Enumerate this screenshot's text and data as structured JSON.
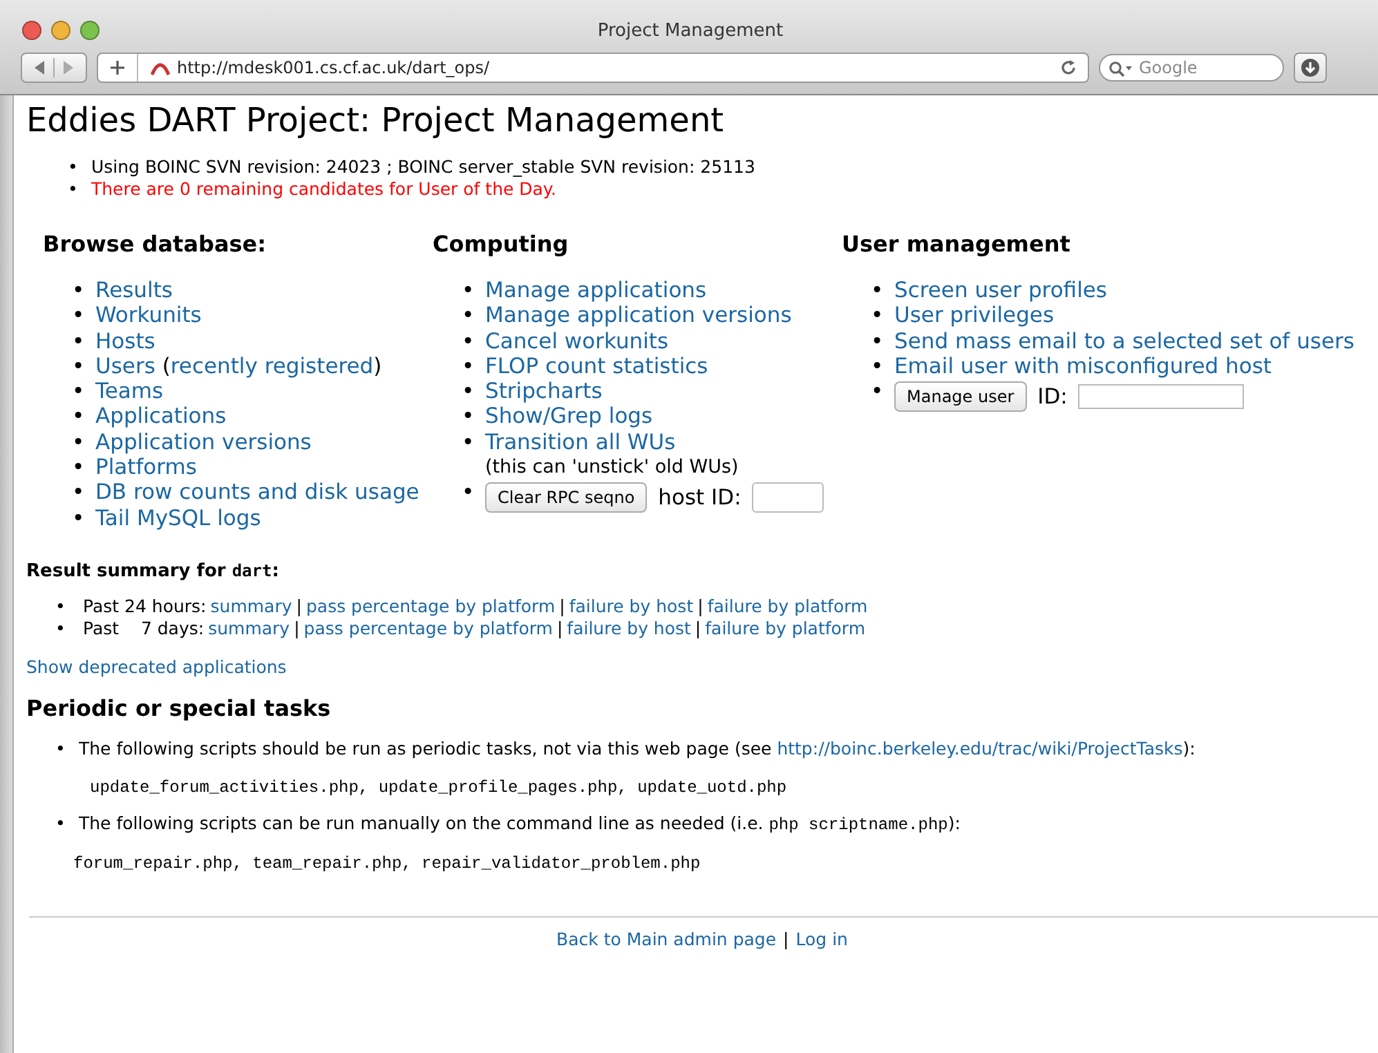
{
  "browser": {
    "title": "Project Management",
    "url": "http://mdesk001.cs.cf.ac.uk/dart_ops/",
    "search_placeholder": "Google"
  },
  "heading": "Eddies DART Project: Project Management",
  "bullet": "•",
  "notes": [
    {
      "text": "Using BOINC SVN revision: 24023 ; BOINC server_stable SVN revision: 25113",
      "kind": "normal"
    },
    {
      "text": "There are 0 remaining candidates for User of the Day.",
      "kind": "warning"
    }
  ],
  "columns": [
    {
      "title": "Browse database:",
      "items": [
        {
          "kind": "link",
          "label": "Results"
        },
        {
          "kind": "link",
          "label": "Workunits"
        },
        {
          "kind": "link",
          "label": "Hosts"
        },
        {
          "kind": "mixed",
          "parts": [
            {
              "text": "Users",
              "kind": "link"
            },
            {
              "text": " (",
              "kind": "text"
            },
            {
              "text": "recently registered",
              "kind": "link"
            },
            {
              "text": ")",
              "kind": "text"
            }
          ]
        },
        {
          "kind": "link",
          "label": "Teams"
        },
        {
          "kind": "link",
          "label": "Applications"
        },
        {
          "kind": "link",
          "label": "Application versions"
        },
        {
          "kind": "link",
          "label": "Platforms"
        },
        {
          "kind": "link",
          "label": "DB row counts and disk usage"
        },
        {
          "kind": "link",
          "label": "Tail MySQL logs"
        }
      ]
    },
    {
      "title": "Computing",
      "items": [
        {
          "kind": "link",
          "label": "Manage applications"
        },
        {
          "kind": "link",
          "label": "Manage application versions"
        },
        {
          "kind": "link",
          "label": "Cancel workunits"
        },
        {
          "kind": "link",
          "label": "FLOP count statistics"
        },
        {
          "kind": "link",
          "label": "Stripcharts"
        },
        {
          "kind": "link",
          "label": "Show/Grep logs"
        },
        {
          "kind": "link",
          "label": "Transition all WUs",
          "note": "(this can 'unstick' old WUs)"
        },
        {
          "kind": "form",
          "button": "Clear RPC seqno",
          "field_label": "host ID:"
        }
      ]
    },
    {
      "title": "User management",
      "items": [
        {
          "kind": "link",
          "label": "Screen user profiles"
        },
        {
          "kind": "link",
          "label": "User privileges"
        },
        {
          "kind": "link",
          "label": "Send mass email to a selected set of users"
        },
        {
          "kind": "link",
          "label": "Email user with misconfigured host"
        },
        {
          "kind": "form",
          "button": "Manage user",
          "field_label": "ID:"
        }
      ]
    }
  ],
  "result_summary": {
    "title": "Result summary for ",
    "app": "dart",
    "colon": ":",
    "separator": "|",
    "rows": [
      {
        "label": "Past 24 hours:",
        "links": [
          "summary",
          "pass percentage by platform",
          "failure by host",
          "failure by platform"
        ]
      },
      {
        "label": "Past    7 days:",
        "links": [
          "summary",
          "pass percentage by platform",
          "failure by host",
          "failure by platform"
        ]
      }
    ]
  },
  "deprecated_link": "Show deprecated applications",
  "periodic": {
    "title": "Periodic or special tasks",
    "items": [
      {
        "parts": [
          {
            "text": "The following scripts should be run as periodic tasks, not via this web page (see ",
            "kind": "text"
          },
          {
            "text": "http://boinc.berkeley.edu/trac/wiki/ProjectTasks",
            "kind": "link"
          },
          {
            "text": "):",
            "kind": "text"
          }
        ],
        "code": "update_forum_activities.php, update_profile_pages.php, update_uotd.php"
      },
      {
        "parts": [
          {
            "text": "The following scripts can be run manually on the command line as needed (i.e. ",
            "kind": "text"
          },
          {
            "text": "php scriptname.php",
            "kind": "code"
          },
          {
            "text": "):",
            "kind": "text"
          }
        ],
        "code": "forum_repair.php, team_repair.php, repair_validator_problem.php"
      }
    ]
  },
  "footer": {
    "links": [
      "Back to Main admin page",
      "Log in"
    ],
    "separator": "|"
  }
}
